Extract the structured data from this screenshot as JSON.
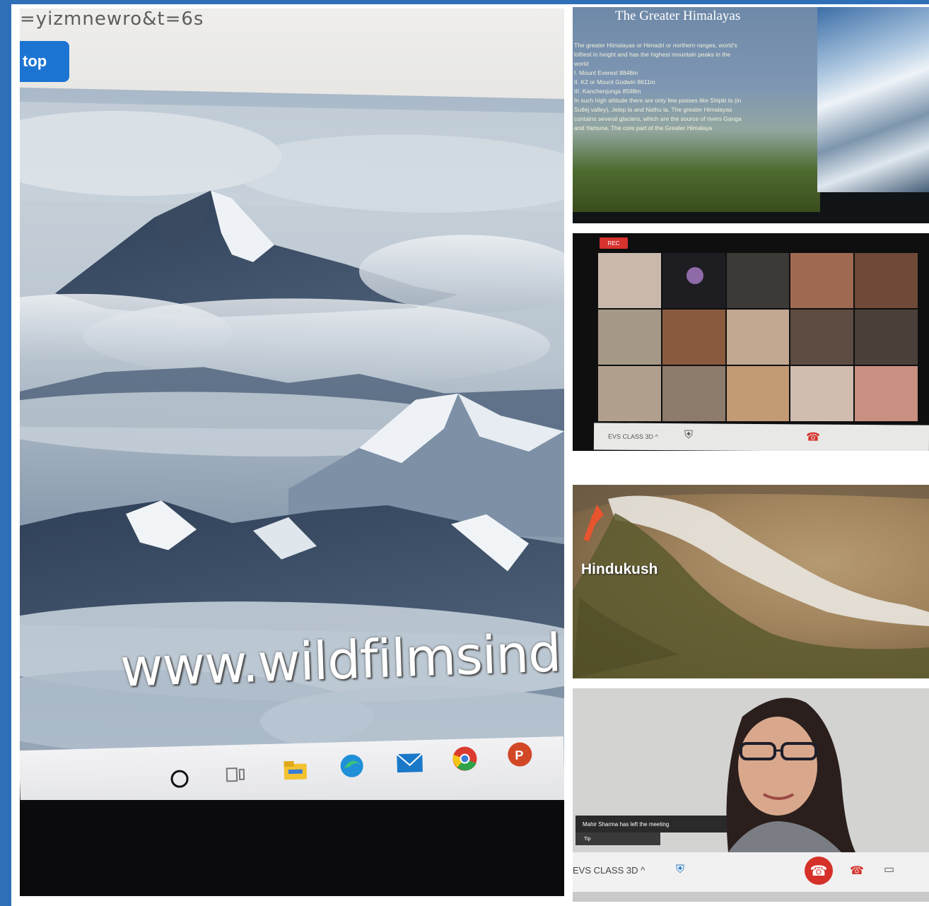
{
  "left_screen": {
    "url_fragment": "=yizmnewro&t=6s",
    "stop_button_label": "top",
    "watermark": "www.wildfilmsind",
    "taskbar_icons": [
      "cortana-circle-icon",
      "task-view-icon",
      "file-explorer-icon",
      "edge-icon",
      "mail-icon",
      "chrome-icon",
      "powerpoint-icon"
    ]
  },
  "slide": {
    "title": "The Greater Himalayas",
    "lines": [
      "The greater Himalayas or Himadri or northern ranges, world's",
      "loftiest in height and has the highest mountain peaks in the",
      "world",
      "I.      Mount Everest 8848m",
      "II.     K2 or Mount Godwin 8611m",
      "III.    Kanchenjunga 8598m",
      "In such high altitude there are only few passes like Shipki la (in",
      "Sutlej valley), Jelep la and Nathu la. The greater Himalayas",
      "contains several glaciers, which are the source of rivers Ganga",
      "and Yamuna. The core part of the Greater Himalaya"
    ]
  },
  "meeting": {
    "rec_label": "REC",
    "bottom_label": "EVS CLASS 3D ^"
  },
  "map": {
    "label": "Hindukush"
  },
  "call": {
    "toast": "Mahir Sharma has left the meeting",
    "toast_sub": "Tip",
    "class_label": "EVS CLASS 3D ^",
    "end_call_color": "#d53129"
  },
  "colors": {
    "frame": "#2f6fb8",
    "stop_button": "#1c74d2"
  }
}
